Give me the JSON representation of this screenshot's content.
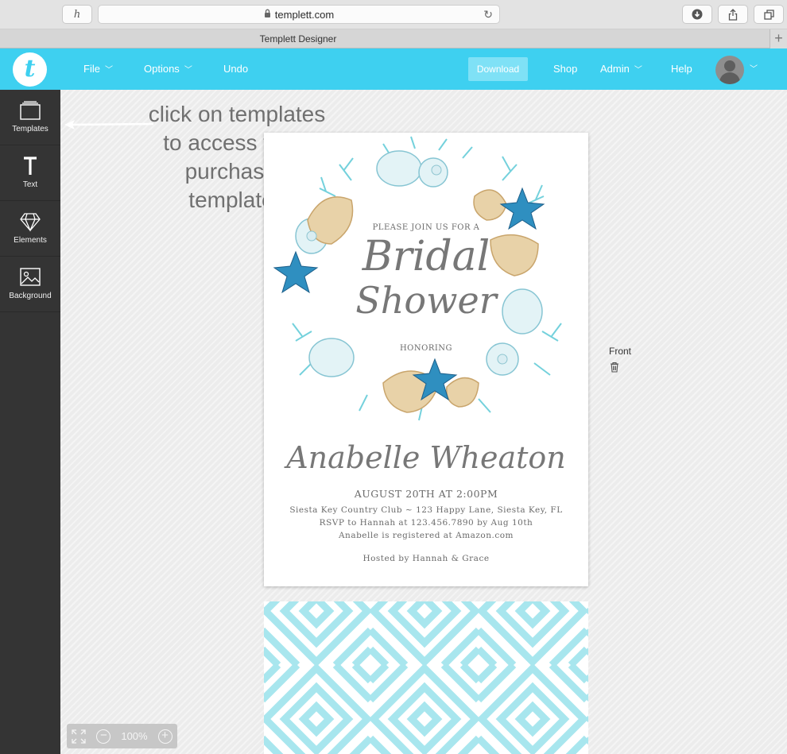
{
  "browser": {
    "history_glyph": "h",
    "url": "templett.com",
    "tab_title": "Templett Designer",
    "new_tab_glyph": "+"
  },
  "header": {
    "logo_letter": "t",
    "nav": [
      {
        "label": "File"
      },
      {
        "label": "Options"
      },
      {
        "label": "Undo"
      },
      {
        "label": "Download"
      },
      {
        "label": "Shop"
      },
      {
        "label": "Admin"
      },
      {
        "label": "Help"
      }
    ],
    "colors": {
      "brand": "#3ed0f0",
      "download_bg": "#7fe1f6"
    }
  },
  "sidebar": {
    "items": [
      {
        "label": "Templates",
        "icon": "templates-icon"
      },
      {
        "label": "Text",
        "icon": "text-icon"
      },
      {
        "label": "Elements",
        "icon": "diamond-icon"
      },
      {
        "label": "Background",
        "icon": "image-icon"
      }
    ]
  },
  "annotation": {
    "lines": [
      "click on templates",
      "to access your",
      "purchased",
      "templates"
    ]
  },
  "card": {
    "intro": "PLEASE JOIN US FOR A",
    "title_line1": "Bridal",
    "title_line2": "Shower",
    "honoring": "HONORING",
    "name": "Anabelle Wheaton",
    "date": "AUGUST 20TH AT 2:00PM",
    "details": [
      "Siesta Key Country Club ~ 123 Happy Lane, Siesta Key, FL",
      "RSVP to Hannah at 123.456.7890 by Aug 10th",
      "Anabelle is registered at Amazon.com"
    ],
    "hosted": "Hosted by Hannah & Grace"
  },
  "side_panel": {
    "front_label": "Front"
  },
  "zoom": {
    "level": "100%"
  }
}
